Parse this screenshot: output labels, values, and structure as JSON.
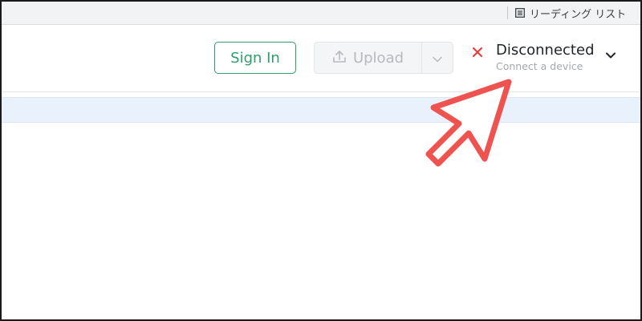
{
  "browser": {
    "reading_list_label": "リーディング リスト",
    "reading_list_icon": "reading-list-icon"
  },
  "header": {
    "sign_in_label": "Sign In",
    "upload_label": "Upload",
    "upload_icon": "upload-icon",
    "upload_dropdown_icon": "chevron-down-icon"
  },
  "device": {
    "status_title": "Disconnected",
    "status_subtitle": "Connect a device",
    "status_icon": "close-icon",
    "status_color": "#e53935",
    "dropdown_icon": "chevron-down-icon"
  },
  "annotation": {
    "arrow_color": "#ef5350",
    "arrow_icon": "pointer-arrow-icon"
  },
  "colors": {
    "accent_green": "#2f9e6a",
    "selected_row": "#e9f2fc"
  }
}
